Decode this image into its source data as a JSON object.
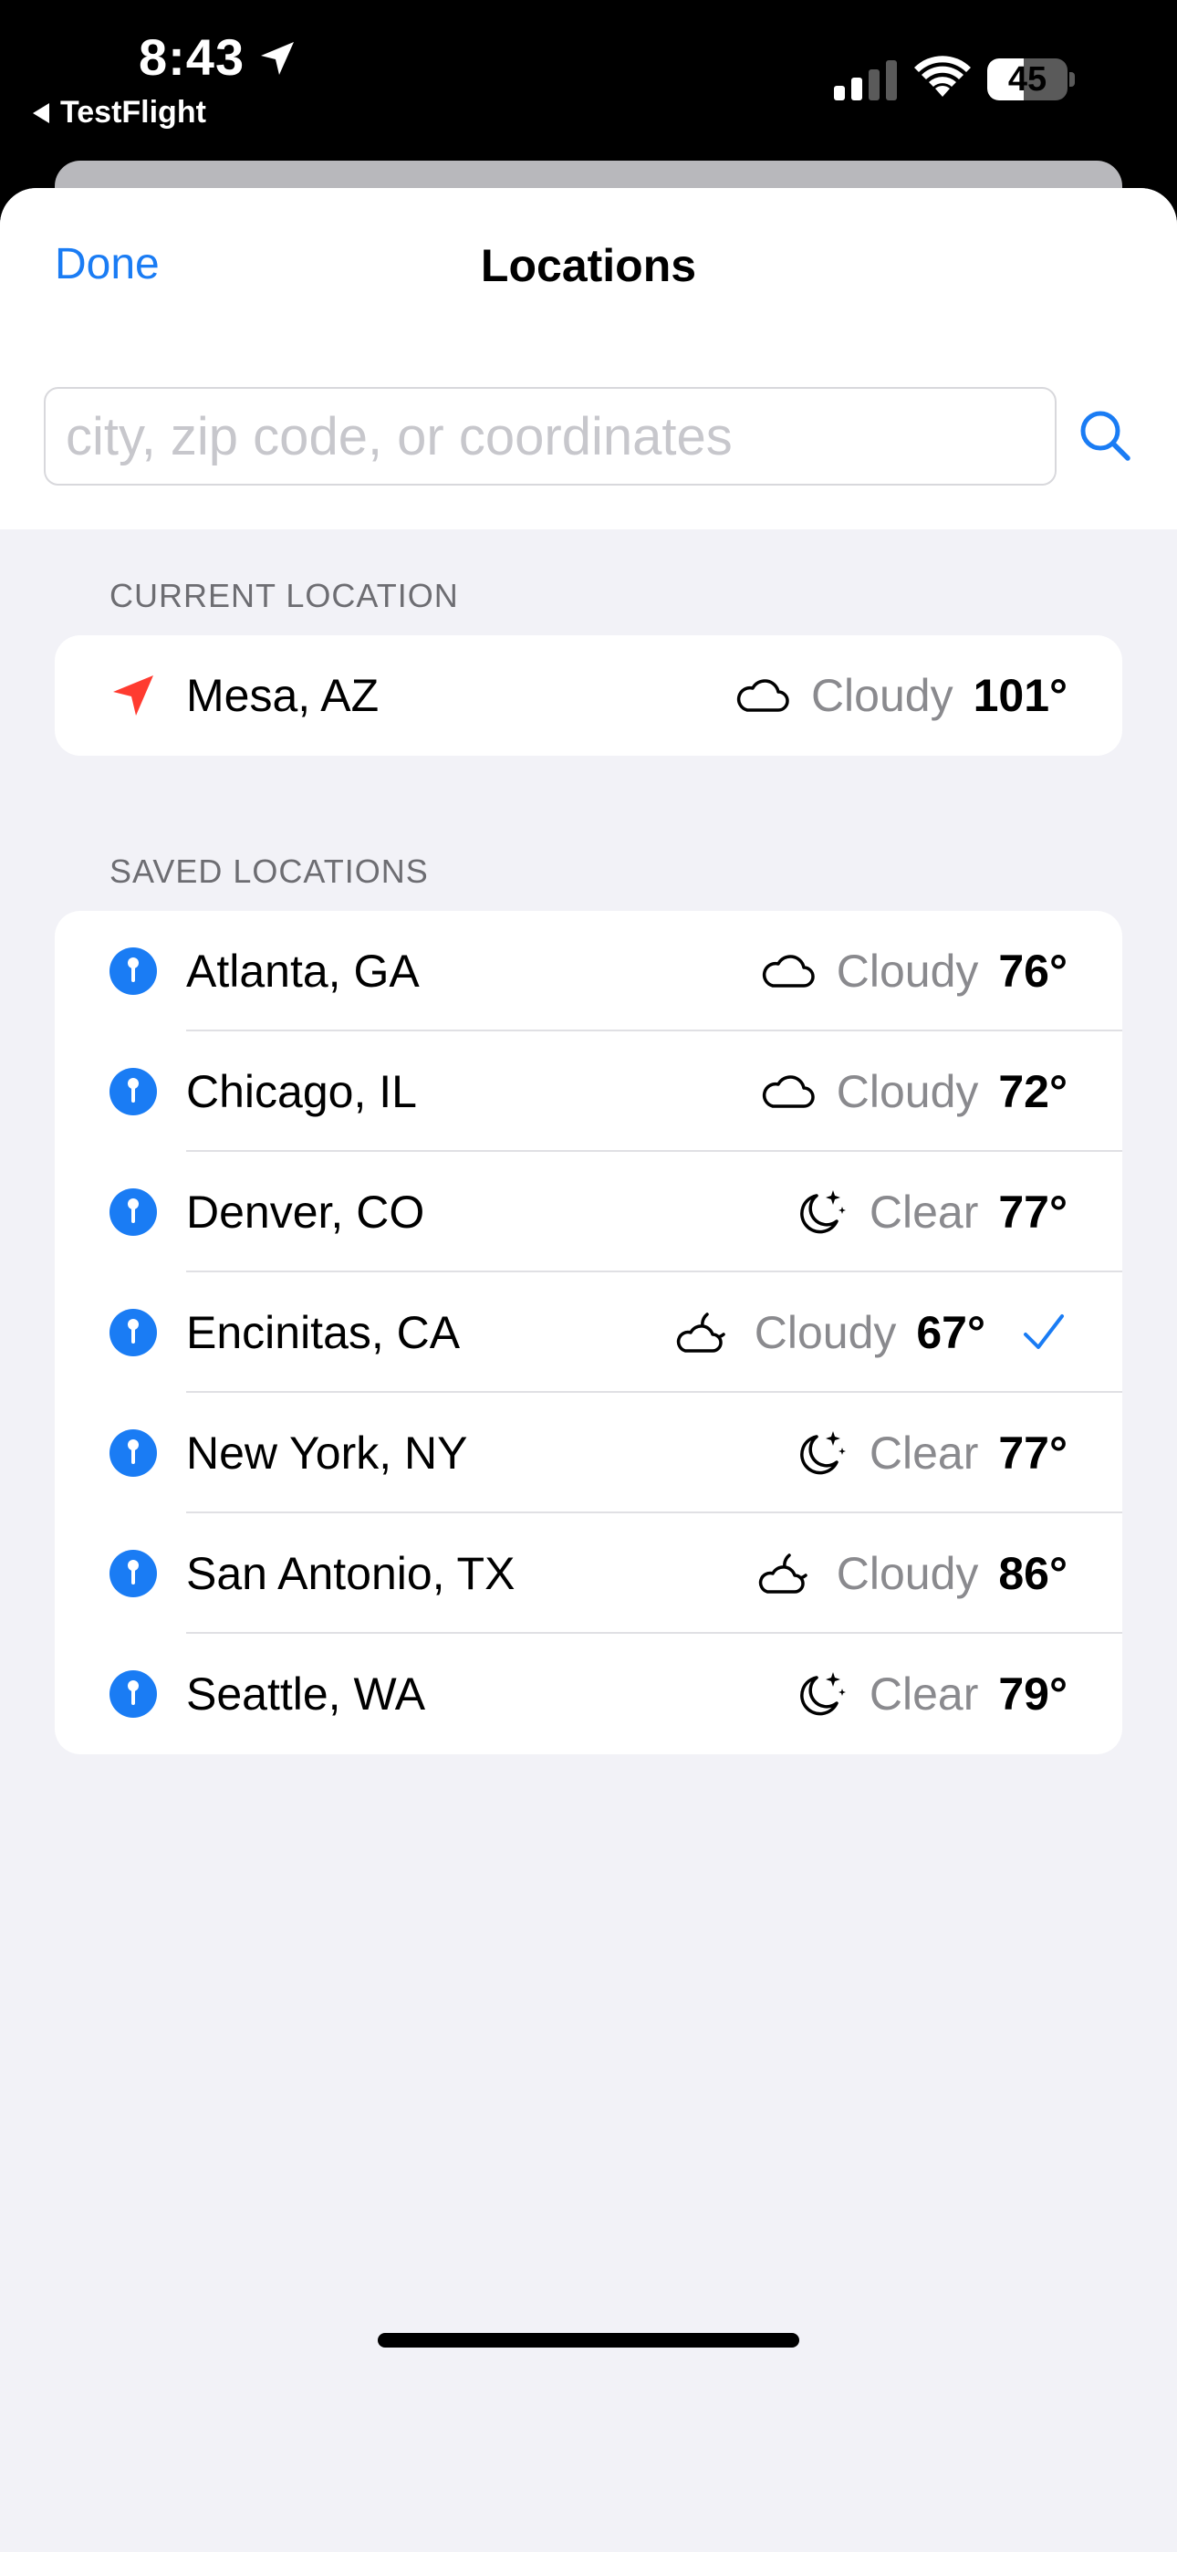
{
  "status_bar": {
    "time": "8:43",
    "back_app": "TestFlight",
    "battery": "45",
    "battery_level": 0.45,
    "location_arrow_icon": "location-arrow-icon",
    "signal_icon": "cellular-signal-icon",
    "wifi_icon": "wifi-icon"
  },
  "header": {
    "done_label": "Done",
    "title": "Locations"
  },
  "search": {
    "placeholder": "city, zip code, or coordinates",
    "value": "",
    "icon": "search-icon"
  },
  "current_location": {
    "section_label": "CURRENT LOCATION",
    "icon": "location-arrow-icon",
    "accent": "#ff3b30",
    "city": "Mesa, AZ",
    "condition": "Cloudy",
    "condition_icon": "cloud-icon",
    "temp": "101°"
  },
  "saved_locations": {
    "section_label": "SAVED LOCATIONS",
    "pin_icon": "map-pin-icon",
    "accent": "#1a7cf4",
    "items": [
      {
        "city": "Atlanta, GA",
        "condition": "Cloudy",
        "condition_icon": "cloud-icon",
        "temp": "76°",
        "selected": false
      },
      {
        "city": "Chicago, IL",
        "condition": "Cloudy",
        "condition_icon": "cloud-icon",
        "temp": "72°",
        "selected": false
      },
      {
        "city": "Denver, CO",
        "condition": "Clear",
        "condition_icon": "moon-stars-icon",
        "temp": "77°",
        "selected": false
      },
      {
        "city": "Encinitas, CA",
        "condition": "Cloudy",
        "condition_icon": "cloud-moon-icon",
        "temp": "67°",
        "selected": true
      },
      {
        "city": "New York, NY",
        "condition": "Clear",
        "condition_icon": "moon-stars-icon",
        "temp": "77°",
        "selected": false
      },
      {
        "city": "San Antonio, TX",
        "condition": "Cloudy",
        "condition_icon": "cloud-moon-icon",
        "temp": "86°",
        "selected": false
      },
      {
        "city": "Seattle, WA",
        "condition": "Clear",
        "condition_icon": "moon-stars-icon",
        "temp": "79°",
        "selected": false
      }
    ]
  },
  "colors": {
    "accent_blue": "#1a7cf4",
    "location_red": "#ff3b30",
    "background": "#f2f2f7"
  }
}
